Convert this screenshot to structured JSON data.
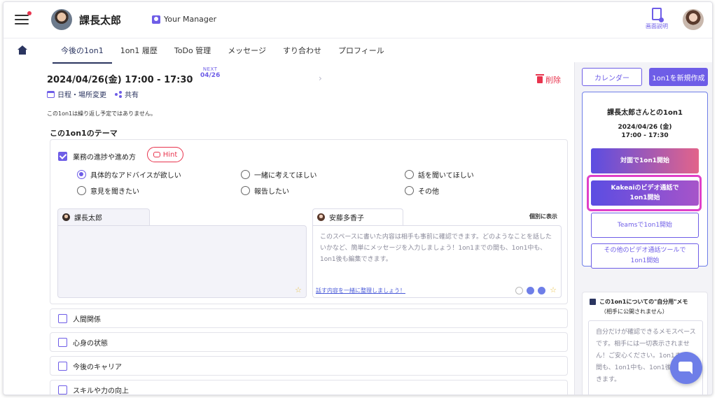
{
  "header": {
    "user_name": "課長太郎",
    "manager_label": "Your Manager",
    "help_label": "画面説明",
    "notification_color": "#e8344e"
  },
  "tabs": [
    {
      "label": "今後の1on1",
      "active": true
    },
    {
      "label": "1on1 履歴"
    },
    {
      "label": "ToDo 管理"
    },
    {
      "label": "メッセージ"
    },
    {
      "label": "すり合わせ"
    },
    {
      "label": "プロフィール"
    }
  ],
  "meeting": {
    "date_time": "2024/04/26(金) 17:00 - 17:30",
    "next_label": "NEXT",
    "next_date": "04/26",
    "delete_label": "削除",
    "reschedule_label": "日程・場所変更",
    "share_label": "共有",
    "repeat_note": "この1on1は繰り返し予定ではありません。"
  },
  "theme": {
    "section_title": "この1on1のテーマ",
    "main_topic": "業務の進捗や進め方",
    "hint_label": "Hint",
    "options": [
      {
        "label": "具体的なアドバイスが欲しい",
        "selected": true
      },
      {
        "label": "一緒に考えてほしい",
        "selected": false
      },
      {
        "label": "話を聞いてほしい",
        "selected": false
      },
      {
        "label": "意見を聞きたい",
        "selected": false
      },
      {
        "label": "報告したい",
        "selected": false
      },
      {
        "label": "その他",
        "selected": false
      }
    ],
    "memo_left_name": "課長太郎",
    "memo_right_name": "安藤多香子",
    "individual_view_label": "個別に表示",
    "memo_placeholder": "このスペースに書いた内容は相手も事前に確認できます。どのようなことを話したいかなど、簡単にメッセージを入力しましょう！1on1までの間も、1on1中も、1on1後も編集できます。",
    "organize_link": "話す内容を一緒に整理しましょう！",
    "other_topics": [
      "人間関係",
      "心身の状態",
      "今後のキャリア",
      "スキルや力の向上"
    ]
  },
  "side": {
    "calendar_label": "カレンダー",
    "new_label": "1on1を新規作成",
    "session_title": "課長太郎さんとの1on1",
    "session_date": "2024/04/26 (金)",
    "session_time": "17:00 - 17:30",
    "face_to_face_label": "対面で1on1開始",
    "kakeai_line1": "Kakeaiのビデオ通話で",
    "kakeai_line2": "1on1開始",
    "teams_label": "Teamsで1on1開始",
    "other_tool_line1": "その他のビデオ通話ツールで",
    "other_tool_line2": "1on1開始",
    "private_memo_title": "この1on1についての\"自分用\"メモ",
    "private_memo_sub": "（相手に公開されません）",
    "private_memo_placeholder": "自分だけが確認できるメモスペースです。相手には一切表示されません！ご安心ください。1on1までの間も、1on1中も、1on1後も編集できます。"
  },
  "colors": {
    "accent": "#6e5de7",
    "navy": "#2b3560",
    "danger": "#e8344e",
    "highlight": "#e03fc8"
  }
}
